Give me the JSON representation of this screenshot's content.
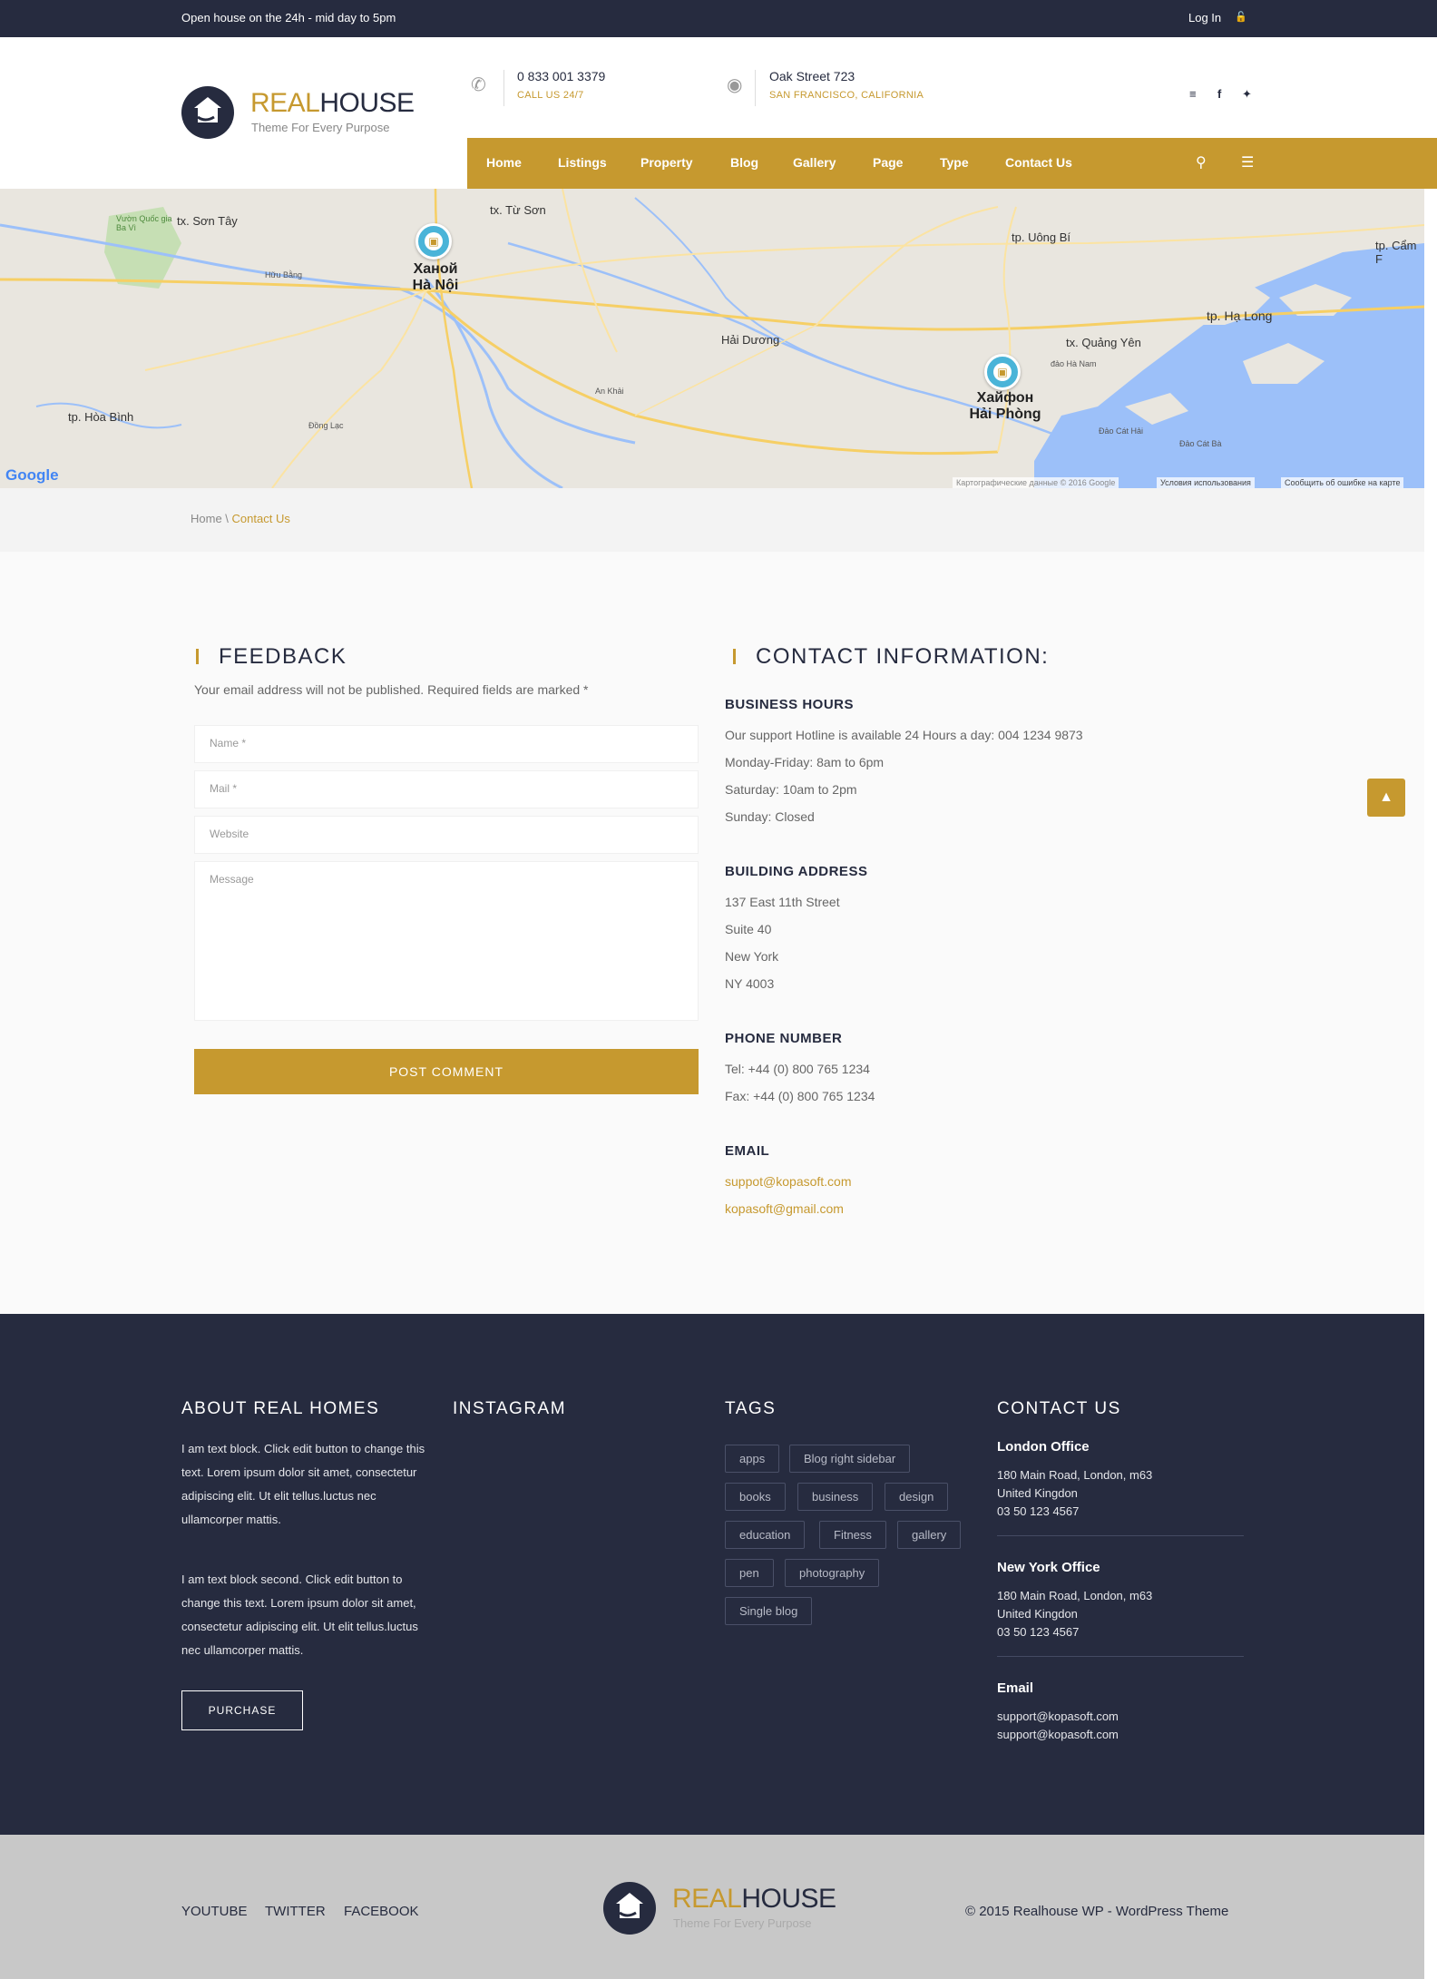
{
  "topbar": {
    "notice": "Open house on the 24h - mid day to 5pm",
    "login": "Log In"
  },
  "header": {
    "brand_a": "REAL",
    "brand_b": "HOUSE",
    "tagline": "Theme For Every Purpose",
    "phone": "0 833 001 3379",
    "phone_sub": "CALL US 24/7",
    "address": "Oak Street 723",
    "address_sub": "SAN FRANCISCO, CALIFORNIA"
  },
  "nav": {
    "items": [
      "Home",
      "Listings",
      "Property",
      "Blog",
      "Gallery",
      "Page",
      "Type",
      "Contact Us"
    ]
  },
  "map": {
    "labels": {
      "son_tay": "tx. Sơn Tây",
      "vuon_quoc": "Vườn Quốc gia Ba Vì",
      "tu_son": "tx. Từ Sơn",
      "huu_bang": "Hữu Bằng",
      "hai_duong": "Hải Dương",
      "uong_bi": "tp. Uông Bí",
      "cam_pha": "tp. Cẩm F",
      "ha_long": "tp. Hạ Long",
      "quang_yen": "tx. Quảng Yên",
      "hoa_binh": "tp. Hòa Bình",
      "dong_lac": "Đồng Lạc",
      "an_khai": "An Khải",
      "dao_cat_hai": "Đảo Cát Hải",
      "dao_cat_ba": "Đảo Cát Bà",
      "dao_ha_nam": "đảo Hà Nam"
    },
    "pin1_label": "Ханой\nHà Nội",
    "pin2_label": "Хайфон\nHải Phòng",
    "google": "Google",
    "attribution": "Картографические данные © 2016 Google",
    "terms": "Условия использования",
    "report": "Сообщить об ошибке на карте"
  },
  "breadcrumb": {
    "home": "Home",
    "sep": " \\ ",
    "current": "Contact Us"
  },
  "feedback": {
    "title": "FEEDBACK",
    "note": "Your email address will not be published. Required fields are marked *",
    "name_placeholder": "Name *",
    "mail_placeholder": "Mail *",
    "website_placeholder": "Website",
    "message_placeholder": "Message",
    "submit": "POST COMMENT"
  },
  "contact_info": {
    "title": "CONTACT INFORMATION:",
    "hours_title": "BUSINESS HOURS",
    "hours": [
      "Our support Hotline is available 24 Hours a day: 004 1234 9873",
      "Monday-Friday: 8am to 6pm",
      "Saturday: 10am to 2pm",
      "Sunday: Closed"
    ],
    "address_title": "BUILDING ADDRESS",
    "address": [
      "137 East 11th Street",
      "Suite 40",
      "New York",
      "NY 4003"
    ],
    "phone_title": "PHONE NUMBER",
    "phones": [
      "Tel: +44 (0) 800 765 1234",
      "Fax: +44 (0) 800 765 1234"
    ],
    "email_title": "EMAIL",
    "emails": [
      "suppot@kopasoft.com",
      "kopasoft@gmail.com"
    ]
  },
  "footer": {
    "about_title": "ABOUT REAL HOMES",
    "about_p1": "I am text block. Click edit button to change this text. Lorem ipsum dolor sit amet, consectetur adipiscing elit. Ut elit tellus.luctus nec ullamcorper mattis.",
    "about_p2": "I am text block second. Click edit button to change this text. Lorem ipsum dolor sit amet, consectetur adipiscing elit. Ut elit tellus.luctus nec ullamcorper mattis.",
    "purchase": "PURCHASE",
    "instagram_title": "INSTAGRAM",
    "tags_title": "TAGS",
    "tags": [
      "apps",
      "Blog right sidebar",
      "books",
      "business",
      "design",
      "education",
      "Fitness",
      "gallery",
      "pen",
      "photography",
      "Single blog"
    ],
    "contact_title": "CONTACT US",
    "london_title": "London Office",
    "london": [
      "180 Main Road, London, m63",
      "United Kingdon",
      "03 50 123 4567"
    ],
    "ny_title": "New York Office",
    "ny": [
      "180 Main Road, London, m63",
      "United Kingdon",
      "03 50 123 4567"
    ],
    "email_title": "Email",
    "emails": [
      "support@kopasoft.com",
      "support@kopasoft.com"
    ]
  },
  "bottom": {
    "links": [
      "YOUTUBE",
      "TWITTER",
      "FACEBOOK"
    ],
    "brand_a": "REAL",
    "brand_b": "HOUSE",
    "tagline": "Theme For Every Purpose",
    "copyright": "© 2015 Realhouse WP - WordPress Theme"
  },
  "colors": {
    "accent": "#c6992f",
    "dark": "#262b3f",
    "water": "#9cc0f9"
  }
}
